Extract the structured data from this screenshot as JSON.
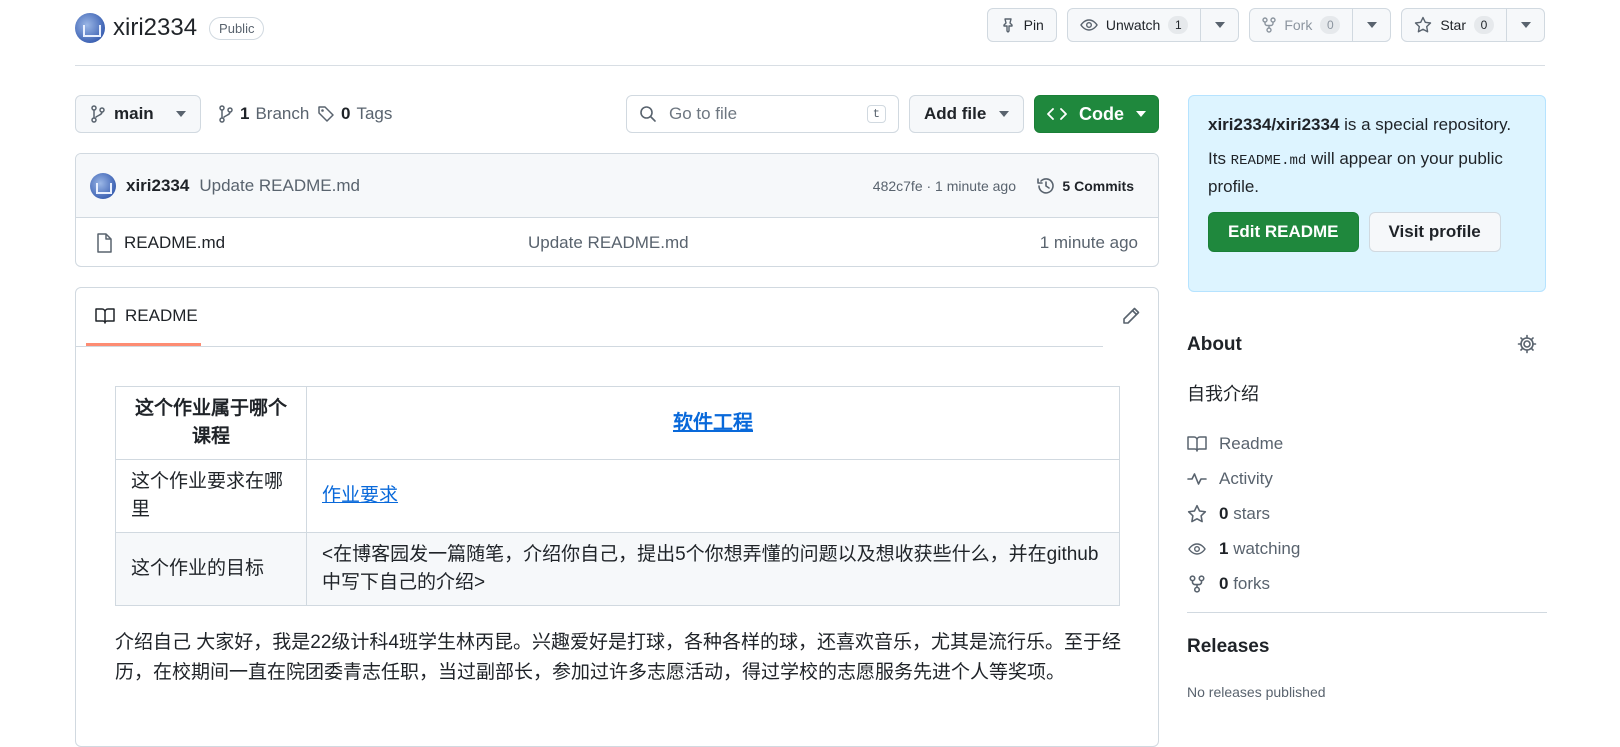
{
  "repo": {
    "owner": "xiri2334",
    "visibility": "Public"
  },
  "header_actions": {
    "pin_label": "Pin",
    "watch_label": "Unwatch",
    "watch_count": "1",
    "fork_label": "Fork",
    "fork_count": "0",
    "star_label": "Star",
    "star_count": "0"
  },
  "toolbar": {
    "branch": "main",
    "branch_count": "1",
    "branch_label": "Branch",
    "tag_count": "0",
    "tag_label": "Tags",
    "search_placeholder": "Go to file",
    "search_shortcut": "t",
    "add_file_label": "Add file",
    "code_label": "Code"
  },
  "latest_commit": {
    "author": "xiri2334",
    "message": "Update README.md",
    "meta": "482c7fe · 1 minute ago",
    "commits_label": "5 Commits"
  },
  "files": [
    {
      "name": "README.md",
      "commit_message": "Update README.md",
      "time": "1 minute ago"
    }
  ],
  "readme": {
    "tab_label": "README",
    "table": {
      "row1_key": "这个作业属于哪个课程",
      "row1_value": "软件工程",
      "row2_key": "这个作业要求在哪里",
      "row2_value": "作业要求",
      "row3_key": "这个作业的目标",
      "row3_value": "<在博客园发一篇随笔，介绍你自己，提出5个你想弄懂的问题以及想收获些什么，并在github中写下自己的介绍>"
    },
    "paragraph": "介绍自己 大家好，我是22级计科4班学生林丙昆。兴趣爱好是打球，各种各样的球，还喜欢音乐，尤其是流行乐。至于经历，在校期间一直在院团委青志任职，当过副部长，参加过许多志愿活动，得过学校的志愿服务先进个人等奖项。"
  },
  "special_box": {
    "repo_path": "xiri2334/xiri2334",
    "line1_suffix": " is a special repository.",
    "line2_prefix": "Its ",
    "line2_code": "README.md",
    "line2_suffix": " will appear on your public profile.",
    "edit_button": "Edit README",
    "visit_button": "Visit profile"
  },
  "about": {
    "title": "About",
    "description": "自我介绍",
    "readme_label": "Readme",
    "activity_label": "Activity",
    "stars_count": "0",
    "stars_label": "stars",
    "watching_count": "1",
    "watching_label": "watching",
    "forks_count": "0",
    "forks_label": "forks"
  },
  "releases": {
    "title": "Releases",
    "note": "No releases published"
  },
  "colors": {
    "primary_green": "#1f883d",
    "link_blue": "#0969da",
    "tab_underline": "#fd8c73",
    "special_box_bg": "#ddf4ff"
  }
}
